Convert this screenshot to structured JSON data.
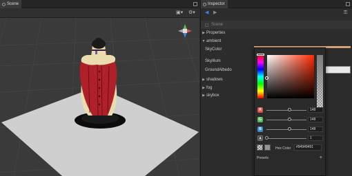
{
  "scene_panel": {
    "tab_label": "Scene"
  },
  "inspector": {
    "tab_label": "Inspector",
    "scene_row": "Scene",
    "sections": [
      {
        "label": "Properties",
        "expanded": false
      },
      {
        "label": "ambient",
        "expanded": true
      },
      {
        "label": "shadows",
        "expanded": false
      },
      {
        "label": "fog",
        "expanded": false
      },
      {
        "label": "skybox",
        "expanded": false
      }
    ],
    "ambient_fields": [
      "SkyColor",
      "SkyIllum",
      "GroundAlbedo"
    ]
  },
  "color_picker": {
    "channels": [
      {
        "label": "R",
        "value": "148",
        "fraction": 0.58,
        "color": "#d9534f"
      },
      {
        "label": "G",
        "value": "148",
        "fraction": 0.58,
        "color": "#5cb85c"
      },
      {
        "label": "B",
        "value": "148",
        "fraction": 0.58,
        "color": "#428bca"
      },
      {
        "label": "A",
        "value": "1",
        "fraction": 0.0,
        "color": "#444444"
      }
    ],
    "hex_label": "Hex Color",
    "hex_value": "#94949491",
    "presets_label": "Presets",
    "presets_add": "+"
  },
  "colors": {
    "accent": "#3d7fd9",
    "picker_strip": "#d3a07a",
    "mannequin_red": "#b0202a",
    "mannequin_cream": "#e9ddb0"
  }
}
